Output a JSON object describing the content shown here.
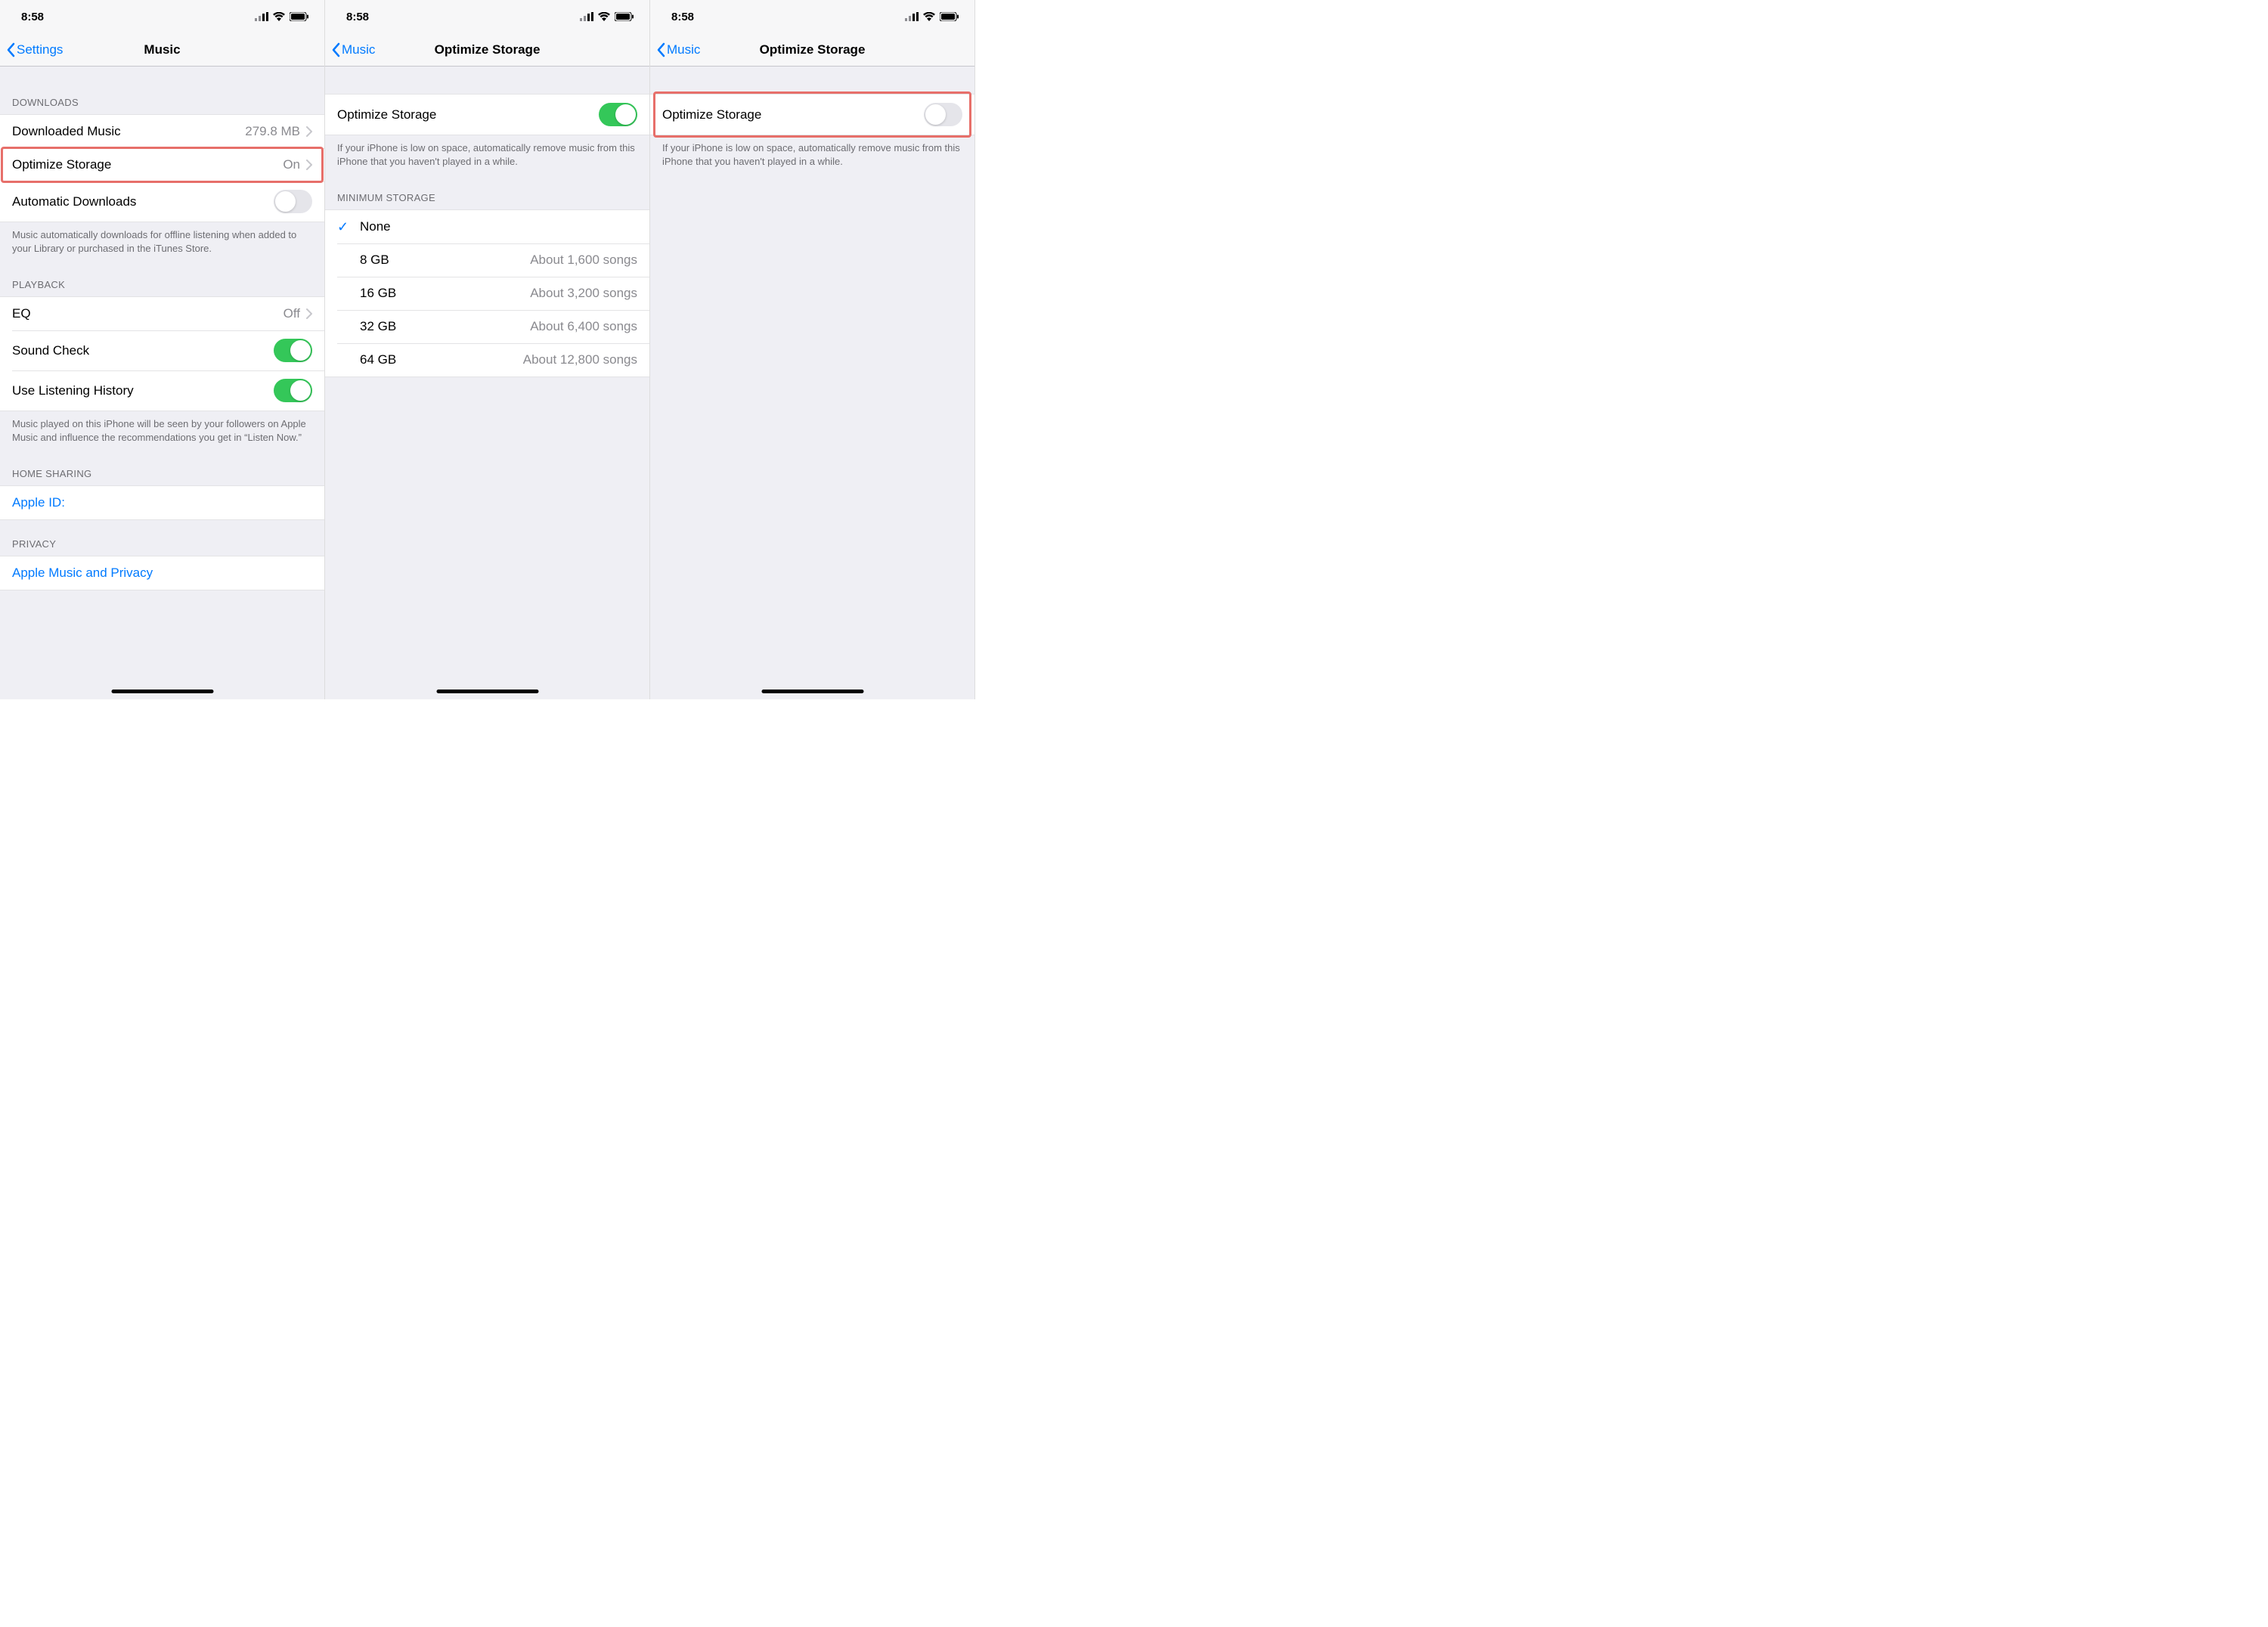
{
  "status": {
    "time": "8:58"
  },
  "screen1": {
    "back": "Settings",
    "title": "Music",
    "sections": {
      "downloads": {
        "header": "DOWNLOADS",
        "downloaded": {
          "label": "Downloaded Music",
          "value": "279.8 MB"
        },
        "optimize": {
          "label": "Optimize Storage",
          "value": "On"
        },
        "auto": {
          "label": "Automatic Downloads"
        },
        "note": "Music automatically downloads for offline listening when added to your Library or purchased in the iTunes Store."
      },
      "playback": {
        "header": "PLAYBACK",
        "eq": {
          "label": "EQ",
          "value": "Off"
        },
        "soundcheck": {
          "label": "Sound Check"
        },
        "history": {
          "label": "Use Listening History"
        },
        "note": "Music played on this iPhone will be seen by your followers on Apple Music and influence the recommendations you get in “Listen Now.”"
      },
      "homesharing": {
        "header": "HOME SHARING",
        "appleid": "Apple ID:"
      },
      "privacy": {
        "header": "PRIVACY",
        "link": "Apple Music and Privacy"
      }
    }
  },
  "screen2": {
    "back": "Music",
    "title": "Optimize Storage",
    "toggle_label": "Optimize Storage",
    "note": "If your iPhone is low on space, automatically remove music from this iPhone that you haven't played in a while.",
    "min_header": "MINIMUM STORAGE",
    "options": [
      {
        "label": "None",
        "detail": "",
        "checked": true
      },
      {
        "label": "8 GB",
        "detail": "About 1,600 songs",
        "checked": false
      },
      {
        "label": "16 GB",
        "detail": "About 3,200 songs",
        "checked": false
      },
      {
        "label": "32 GB",
        "detail": "About 6,400 songs",
        "checked": false
      },
      {
        "label": "64 GB",
        "detail": "About 12,800 songs",
        "checked": false
      }
    ]
  },
  "screen3": {
    "back": "Music",
    "title": "Optimize Storage",
    "toggle_label": "Optimize Storage",
    "note": "If your iPhone is low on space, automatically remove music from this iPhone that you haven't played in a while."
  }
}
